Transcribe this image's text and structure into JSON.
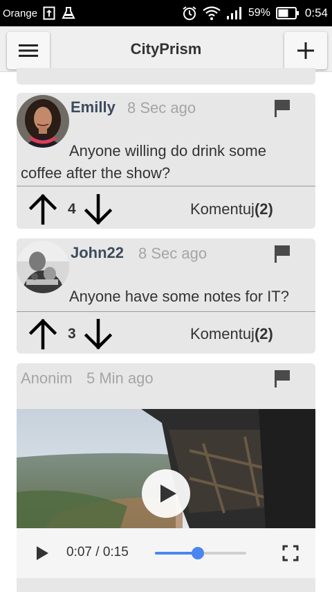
{
  "status_bar": {
    "carrier": "Orange",
    "battery": "59%",
    "time": "0:54"
  },
  "app": {
    "title": "CityPrism"
  },
  "posts": [
    {
      "author": "Emilly",
      "time": "8 Sec ago",
      "text": "Anyone willing do drink some coffee after the show?",
      "votes": "4",
      "comment_label": "Komentuj",
      "comment_count": "(2)"
    },
    {
      "author": "John22",
      "time": "8 Sec ago",
      "text": "Anyone have some notes for IT?",
      "votes": "3",
      "comment_label": "Komentuj",
      "comment_count": "(2)"
    },
    {
      "author": "Anonim",
      "time": "5 Min ago",
      "video": {
        "time_display": "0:07 / 0:15",
        "progress": 0.4667
      }
    }
  ],
  "colors": {
    "accent": "#4a86f0",
    "card_bg": "#e7e7e7",
    "author_color": "#3c4a5c"
  }
}
